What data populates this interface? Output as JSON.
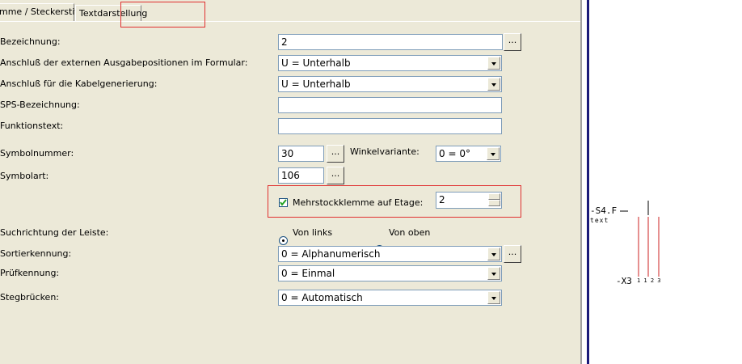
{
  "tabs": [
    {
      "label": "mme / Steckerstift"
    },
    {
      "label": "Textdarstellung"
    }
  ],
  "form": {
    "bezeichnung": {
      "label": "Bezeichnung:",
      "value": "2",
      "button": "..."
    },
    "anschluss_ext": {
      "label": "Anschluß der externen Ausgabepositionen im Formular:",
      "value": "U = Unterhalb"
    },
    "anschluss_kabel": {
      "label": "Anschluß für die Kabelgenerierung:",
      "value": "U = Unterhalb"
    },
    "sps": {
      "label": "SPS-Bezeichnung:",
      "value": ""
    },
    "funktionstext": {
      "label": "Funktionstext:",
      "value": ""
    },
    "symbolnummer": {
      "label": "Symbolnummer:",
      "value": "30",
      "button": "..."
    },
    "winkel": {
      "label": "Winkelvariante:",
      "value": "0 = 0°"
    },
    "symbolart": {
      "label": "Symbolart:",
      "value": "106",
      "button": "..."
    },
    "mehrstock": {
      "label": "Mehrstockklemme auf Etage:",
      "checked": true,
      "value": "2"
    },
    "suchrichtung": {
      "label": "Suchrichtung der Leiste:",
      "option1": "Von links",
      "option2": "Von oben",
      "selected": "Von links"
    },
    "sortierkennung": {
      "label": "Sortierkennung:",
      "value": "0 = Alphanumerisch",
      "button": "..."
    },
    "pruefkennung": {
      "label": "Prüfkennung:",
      "value": "0 = Einmal"
    },
    "stegbruecken": {
      "label": "Stegbrücken:",
      "value": "0 = Automatisch"
    }
  },
  "schematic": {
    "top_label": "-S4.F",
    "sub_label": "text",
    "bottom_label": "-X3",
    "terminals": "1 1 2 3",
    "colors": {
      "wire": "#cc2222",
      "line": "#000000"
    }
  },
  "colors": {
    "dialog_bg": "#ece9d8",
    "highlight": "#e03030"
  }
}
